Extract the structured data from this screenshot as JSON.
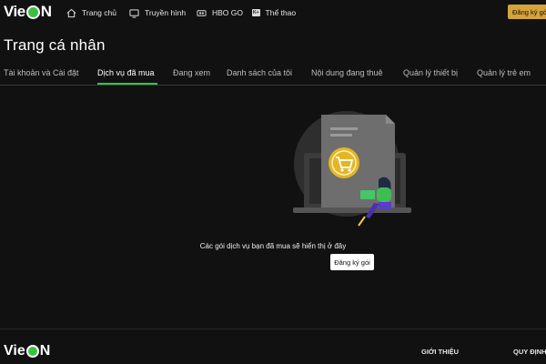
{
  "brand": {
    "logo_left": "Vie",
    "logo_right": "N"
  },
  "topnav": {
    "items": [
      {
        "label": "Trang chủ",
        "icon": "home-icon"
      },
      {
        "label": "Truyền hình",
        "icon": "tv-icon"
      },
      {
        "label": "HBO GO",
        "icon": "hbo-icon"
      },
      {
        "label": "Thể thao",
        "icon": "sport-icon",
        "tag": "K+"
      }
    ],
    "register_label": "Đăng ký gói"
  },
  "page": {
    "title": "Trang cá nhân"
  },
  "tabs": [
    {
      "label": "Tài khoản và Cài đặt"
    },
    {
      "label": "Dịch vụ đã mua",
      "active": true
    },
    {
      "label": "Đang xem"
    },
    {
      "label": "Danh sách của tôi"
    },
    {
      "label": "Nội dung đang thuê"
    },
    {
      "label": "Quản lý thiết bị"
    },
    {
      "label": "Quản lý trẻ em"
    }
  ],
  "empty_state": {
    "message": "Các gói dịch vụ bạn đã mua sẽ hiển thị ở đây",
    "button_label": "Đăng ký gói",
    "illustration": "shopping-cart-illustration"
  },
  "footer": {
    "links": [
      "GIỚI THIỆU",
      "QUY ĐỊNH"
    ]
  },
  "colors": {
    "accent": "#3ac142",
    "register": "#d6a23a",
    "background": "#111111"
  }
}
